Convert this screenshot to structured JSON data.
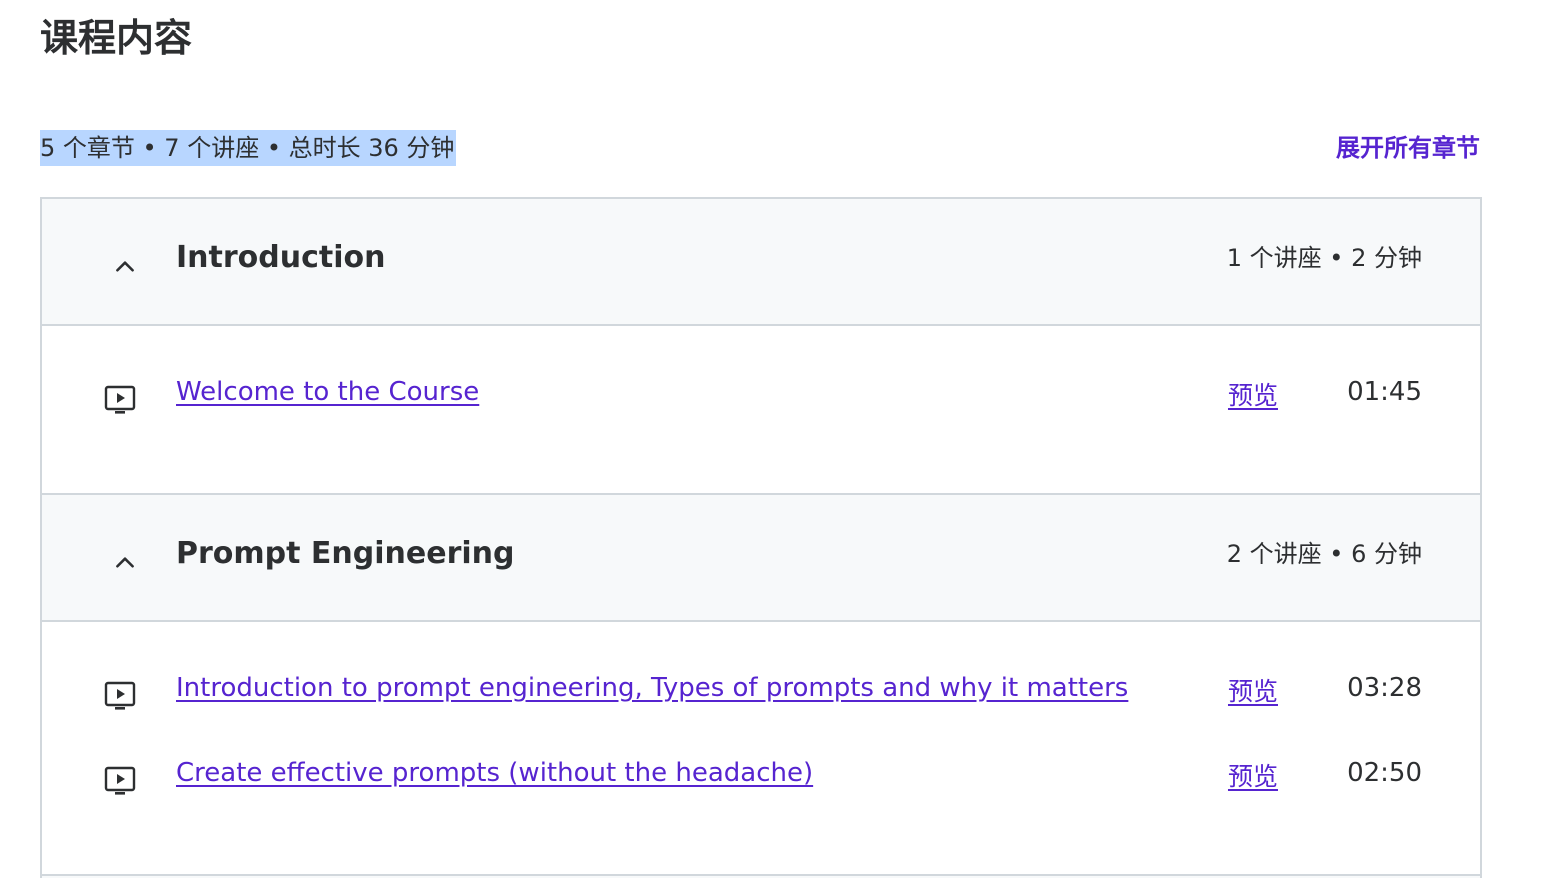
{
  "page": {
    "title": "课程内容"
  },
  "summary": {
    "text": "5 个章节 • 7 个讲座 • 总时长 36 分钟",
    "expand_all_label": "展开所有章节"
  },
  "colors": {
    "accent": "#5624d0",
    "text": "#2d2f31",
    "section_bg": "#f7f9fa",
    "border": "#d1d7dc",
    "selection_highlight": "#b8d6ff"
  },
  "sections": [
    {
      "title": "Introduction",
      "meta": "1 个讲座 • 2 分钟",
      "expanded": true,
      "icon": "chevron-up-icon",
      "lectures": [
        {
          "title": "Welcome to the Course",
          "preview_label": "预览",
          "duration": "01:45",
          "icon": "video-lecture-icon"
        }
      ]
    },
    {
      "title": "Prompt Engineering",
      "meta": "2 个讲座 • 6 分钟",
      "expanded": true,
      "icon": "chevron-up-icon",
      "lectures": [
        {
          "title": "Introduction to prompt engineering, Types of prompts and why it matters",
          "preview_label": "预览",
          "duration": "03:28",
          "icon": "video-lecture-icon"
        },
        {
          "title": "Create effective prompts (without the headache)",
          "preview_label": "预览",
          "duration": "02:50",
          "icon": "video-lecture-icon"
        }
      ]
    }
  ]
}
